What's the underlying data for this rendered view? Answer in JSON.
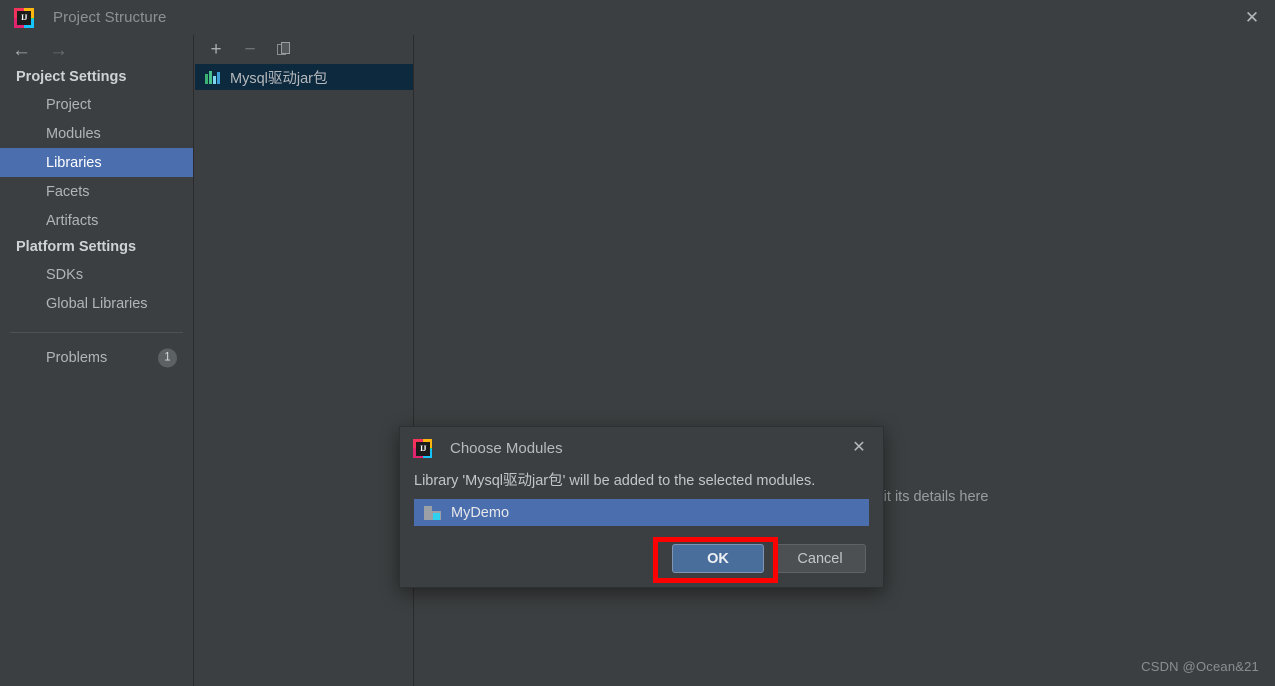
{
  "window": {
    "title": "Project Structure",
    "app_icon": "intellij-idea-icon",
    "icon_letters": "IJ",
    "close_label": "✕"
  },
  "navigation": {
    "back_icon": "←",
    "forward_icon": "→"
  },
  "sidebar": {
    "groups": [
      {
        "heading": "Project Settings",
        "items": [
          {
            "label": "Project",
            "selected": false
          },
          {
            "label": "Modules",
            "selected": false
          },
          {
            "label": "Libraries",
            "selected": true
          },
          {
            "label": "Facets",
            "selected": false
          },
          {
            "label": "Artifacts",
            "selected": false
          }
        ]
      },
      {
        "heading": "Platform Settings",
        "items": [
          {
            "label": "SDKs",
            "selected": false
          },
          {
            "label": "Global Libraries",
            "selected": false
          }
        ]
      }
    ],
    "problems": {
      "label": "Problems",
      "badge": "1"
    }
  },
  "library_panel": {
    "toolbar": {
      "add_label": "+",
      "remove_label": "−",
      "copy_label": "copy-icon"
    },
    "items": [
      {
        "name": "Mysql驱动jar包",
        "icon": "library-icon",
        "selected": true
      }
    ]
  },
  "detail_panel": {
    "hint": "Select a library to view or edit its details here",
    "watermark": "CSDN @Ocean&21"
  },
  "dialog": {
    "title": "Choose Modules",
    "icon": "intellij-idea-icon",
    "icon_letters": "IJ",
    "close_label": "✕",
    "message": "Library 'Mysql驱动jar包' will be added to the selected modules.",
    "modules": [
      {
        "label": "MyDemo",
        "icon": "module-icon",
        "selected": true
      }
    ],
    "ok_label": "OK",
    "cancel_label": "Cancel"
  },
  "annotation": {
    "highlight_color": "#fe0000",
    "target": "ok-button"
  },
  "colors": {
    "background": "#3c3f41",
    "selection_blue": "#4b6eaf",
    "list_selection_dark": "#0d293e",
    "accent_red": "#fe0000"
  }
}
